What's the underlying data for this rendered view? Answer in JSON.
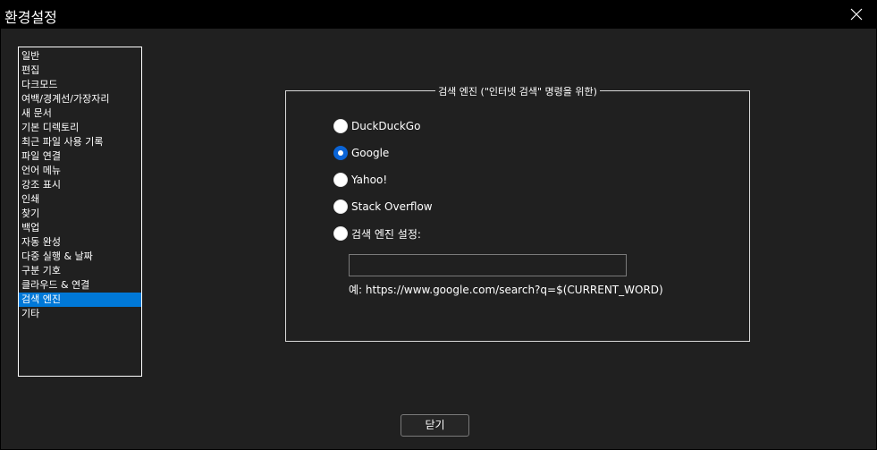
{
  "window": {
    "title": "환경설정",
    "close_icon": "close-icon"
  },
  "sidebar": {
    "items": [
      {
        "label": "일반",
        "selected": false
      },
      {
        "label": "편집",
        "selected": false
      },
      {
        "label": "다크모드",
        "selected": false
      },
      {
        "label": "여백/경계선/가장자리",
        "selected": false
      },
      {
        "label": "새 문서",
        "selected": false
      },
      {
        "label": "기본 디렉토리",
        "selected": false
      },
      {
        "label": "최근 파일 사용 기록",
        "selected": false
      },
      {
        "label": "파일 연결",
        "selected": false
      },
      {
        "label": "언어 메뉴",
        "selected": false
      },
      {
        "label": "강조 표시",
        "selected": false
      },
      {
        "label": "인쇄",
        "selected": false
      },
      {
        "label": "찾기",
        "selected": false
      },
      {
        "label": "백업",
        "selected": false
      },
      {
        "label": "자동 완성",
        "selected": false
      },
      {
        "label": "다중 실행 & 날짜",
        "selected": false
      },
      {
        "label": "구분 기호",
        "selected": false
      },
      {
        "label": "클라우드 & 연결",
        "selected": false
      },
      {
        "label": "검색 엔진",
        "selected": true
      },
      {
        "label": "기타",
        "selected": false
      }
    ]
  },
  "search_engine": {
    "group_title": "검색 엔진 (\"인터넷 검색\" 명령을 위한)",
    "options": [
      {
        "label": "DuckDuckGo",
        "checked": false
      },
      {
        "label": "Google",
        "checked": true
      },
      {
        "label": "Yahoo!",
        "checked": false
      },
      {
        "label": "Stack Overflow",
        "checked": false
      },
      {
        "label": "검색 엔진 설정:",
        "checked": false
      }
    ],
    "custom_value": "",
    "example": "예: https://www.google.com/search?q=$(CURRENT_WORD)"
  },
  "footer": {
    "close_label": "닫기"
  },
  "colors": {
    "selection": "#0078d7",
    "radio_checked": "#0a64d6",
    "background": "#202020"
  }
}
